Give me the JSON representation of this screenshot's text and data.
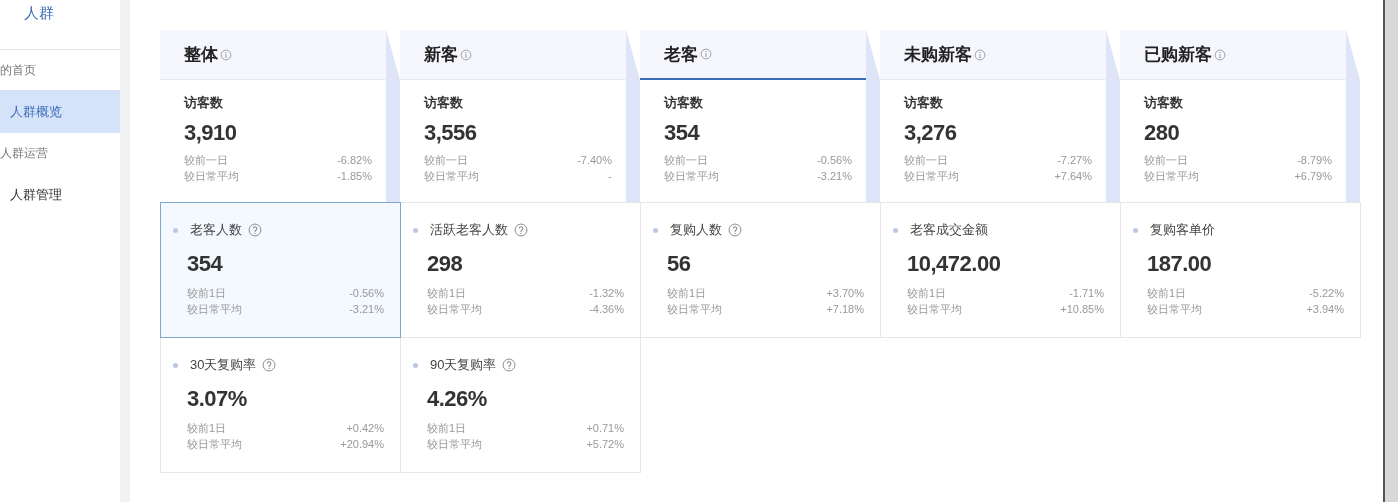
{
  "sidebar": {
    "title": "人群",
    "items": [
      {
        "label": "的首页",
        "kind": "section"
      },
      {
        "label": "人群概览",
        "kind": "link",
        "selected": true
      },
      {
        "label": "人群运营",
        "kind": "section"
      },
      {
        "label": "人群管理",
        "kind": "link",
        "selected": false
      }
    ]
  },
  "segments": [
    {
      "label": "整体",
      "selected": false,
      "card": {
        "label": "访客数",
        "value": "3,910",
        "rows": [
          {
            "label": "较前一日",
            "value": "-6.82%"
          },
          {
            "label": "较日常平均",
            "value": "-1.85%"
          }
        ]
      }
    },
    {
      "label": "新客",
      "selected": false,
      "card": {
        "label": "访客数",
        "value": "3,556",
        "rows": [
          {
            "label": "较前一日",
            "value": "-7.40%"
          },
          {
            "label": "较日常平均",
            "value": "-"
          }
        ]
      }
    },
    {
      "label": "老客",
      "selected": true,
      "card": {
        "label": "访客数",
        "value": "354",
        "rows": [
          {
            "label": "较前一日",
            "value": "-0.56%"
          },
          {
            "label": "较日常平均",
            "value": "-3.21%"
          }
        ]
      }
    },
    {
      "label": "未购新客",
      "selected": false,
      "card": {
        "label": "访客数",
        "value": "3,276",
        "rows": [
          {
            "label": "较前一日",
            "value": "-7.27%"
          },
          {
            "label": "较日常平均",
            "value": "+7.64%"
          }
        ]
      }
    },
    {
      "label": "已购新客",
      "selected": false,
      "card": {
        "label": "访客数",
        "value": "280",
        "rows": [
          {
            "label": "较前一日",
            "value": "-8.79%"
          },
          {
            "label": "较日常平均",
            "value": "+6.79%"
          }
        ]
      }
    }
  ],
  "metrics": [
    {
      "label": "老客人数",
      "help": true,
      "selected": true,
      "value": "354",
      "rows": [
        {
          "label": "较前1日",
          "value": "-0.56%"
        },
        {
          "label": "较日常平均",
          "value": "-3.21%"
        }
      ]
    },
    {
      "label": "活跃老客人数",
      "help": true,
      "selected": false,
      "value": "298",
      "rows": [
        {
          "label": "较前1日",
          "value": "-1.32%"
        },
        {
          "label": "较日常平均",
          "value": "-4.36%"
        }
      ]
    },
    {
      "label": "复购人数",
      "help": true,
      "selected": false,
      "value": "56",
      "rows": [
        {
          "label": "较前1日",
          "value": "+3.70%"
        },
        {
          "label": "较日常平均",
          "value": "+7.18%"
        }
      ]
    },
    {
      "label": "老客成交金额",
      "help": false,
      "selected": false,
      "value": "10,472.00",
      "rows": [
        {
          "label": "较前1日",
          "value": "-1.71%"
        },
        {
          "label": "较日常平均",
          "value": "+10.85%"
        }
      ]
    },
    {
      "label": "复购客单价",
      "help": false,
      "selected": false,
      "value": "187.00",
      "rows": [
        {
          "label": "较前1日",
          "value": "-5.22%"
        },
        {
          "label": "较日常平均",
          "value": "+3.94%"
        }
      ]
    },
    {
      "label": "30天复购率",
      "help": true,
      "selected": false,
      "value": "3.07%",
      "rows": [
        {
          "label": "较前1日",
          "value": "+0.42%"
        },
        {
          "label": "较日常平均",
          "value": "+20.94%"
        }
      ]
    },
    {
      "label": "90天复购率",
      "help": true,
      "selected": false,
      "value": "4.26%",
      "rows": [
        {
          "label": "较前1日",
          "value": "+0.71%"
        },
        {
          "label": "较日常平均",
          "value": "+5.72%"
        }
      ]
    }
  ]
}
